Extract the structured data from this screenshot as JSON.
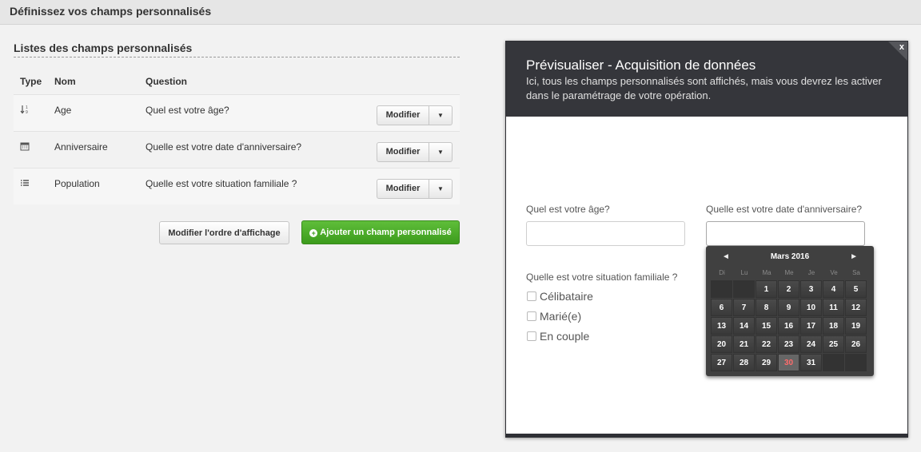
{
  "page": {
    "title": "Définissez vos champs personnalisés"
  },
  "list": {
    "title": "Listes des champs personnalisés",
    "headers": {
      "type": "Type",
      "nom": "Nom",
      "question": "Question"
    },
    "rows": [
      {
        "icon": "sort-numeric-icon",
        "nom": "Age",
        "question": "Quel est votre âge?",
        "button": "Modifier"
      },
      {
        "icon": "calendar-icon",
        "nom": "Anniversaire",
        "question": "Quelle est votre date d'anniversaire?",
        "button": "Modifier"
      },
      {
        "icon": "list-icon",
        "nom": "Population",
        "question": "Quelle est votre situation familiale ?",
        "button": "Modifier"
      }
    ],
    "order_button": "Modifier l'ordre d'affichage",
    "add_button": "Ajouter un champ personnalisé"
  },
  "preview": {
    "title": "Prévisualiser - Acquisition de données",
    "subtitle": "Ici, tous les champs personnalisés sont affichés, mais vous devrez les activer dans le paramétrage de votre opération.",
    "close_label": "x",
    "age_label": "Quel est votre âge?",
    "birthday_label": "Quelle est votre date d'anniversaire?",
    "situation_label": "Quelle est votre situation familiale ?",
    "options": [
      "Célibataire",
      "Marié(e)",
      "En couple"
    ]
  },
  "datepicker": {
    "month_label": "Mars 2016",
    "prev": "◄",
    "next": "►",
    "weekdays": [
      "Di",
      "Lu",
      "Ma",
      "Me",
      "Je",
      "Ve",
      "Sa"
    ],
    "leading_empty": 2,
    "days": [
      "1",
      "2",
      "3",
      "4",
      "5",
      "6",
      "7",
      "8",
      "9",
      "10",
      "11",
      "12",
      "13",
      "14",
      "15",
      "16",
      "17",
      "18",
      "19",
      "20",
      "21",
      "22",
      "23",
      "24",
      "25",
      "26",
      "27",
      "28",
      "29",
      "30",
      "31"
    ],
    "today": "30",
    "trailing_empty": 2
  },
  "colors": {
    "accent_green": "#3c9b1c",
    "modal_header": "#35363b",
    "today": "#ff6b6b"
  }
}
